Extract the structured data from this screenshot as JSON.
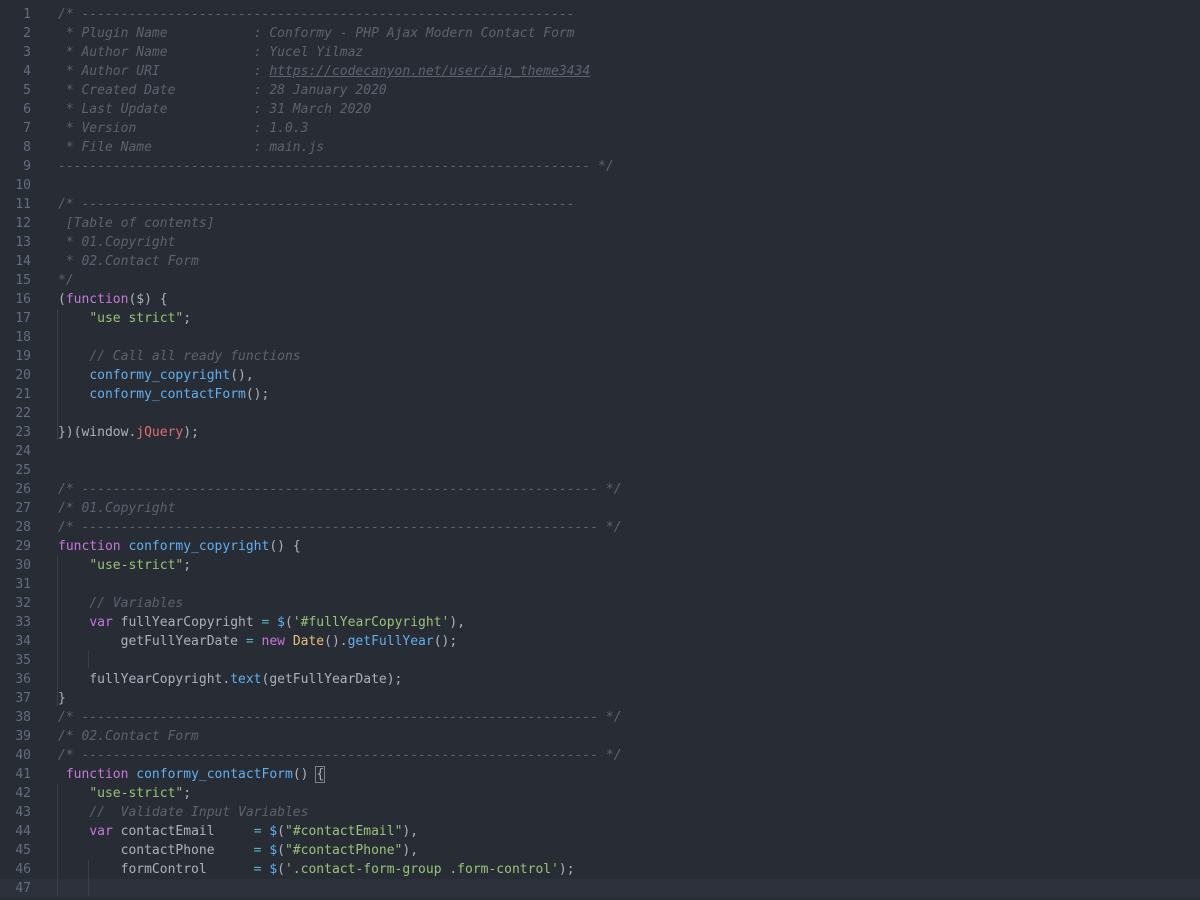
{
  "editor": {
    "active_line": 47,
    "lines": [
      {
        "n": "1",
        "t": [
          [
            "comment",
            "/* ---------------------------------------------------------------"
          ]
        ]
      },
      {
        "n": "2",
        "t": [
          [
            "comment",
            " * Plugin Name           : Conformy - PHP Ajax Modern Contact Form"
          ]
        ]
      },
      {
        "n": "3",
        "t": [
          [
            "comment",
            " * Author Name           : Yucel Yilmaz"
          ]
        ]
      },
      {
        "n": "4",
        "t": [
          [
            "comment",
            " * Author URI            : "
          ],
          [
            "link",
            "https://codecanyon.net/user/aip_theme3434"
          ]
        ]
      },
      {
        "n": "5",
        "t": [
          [
            "comment",
            " * Created Date          : 28 January 2020"
          ]
        ]
      },
      {
        "n": "6",
        "t": [
          [
            "comment",
            " * Last Update           : 31 March 2020"
          ]
        ]
      },
      {
        "n": "7",
        "t": [
          [
            "comment",
            " * Version               : 1.0.3"
          ]
        ]
      },
      {
        "n": "8",
        "t": [
          [
            "comment",
            " * File Name             : main.js"
          ]
        ]
      },
      {
        "n": "9",
        "t": [
          [
            "comment",
            "-------------------------------------------------------------------- */"
          ]
        ]
      },
      {
        "n": "10",
        "t": []
      },
      {
        "n": "11",
        "t": [
          [
            "comment",
            "/* ---------------------------------------------------------------"
          ]
        ]
      },
      {
        "n": "12",
        "t": [
          [
            "comment",
            " [Table of contents]"
          ]
        ]
      },
      {
        "n": "13",
        "t": [
          [
            "comment",
            " * 01.Copyright"
          ]
        ]
      },
      {
        "n": "14",
        "t": [
          [
            "comment",
            " * 02.Contact Form"
          ]
        ]
      },
      {
        "n": "15",
        "t": [
          [
            "comment",
            "*/"
          ]
        ]
      },
      {
        "n": "16",
        "t": [
          [
            "plain",
            "("
          ],
          [
            "keyword",
            "function"
          ],
          [
            "plain",
            "($) {"
          ]
        ]
      },
      {
        "n": "17",
        "t": [
          [
            "plain",
            "    "
          ],
          [
            "string",
            "\"use strict\""
          ],
          [
            "plain",
            ";"
          ]
        ]
      },
      {
        "n": "18",
        "t": []
      },
      {
        "n": "19",
        "t": [
          [
            "plain",
            "    "
          ],
          [
            "comment",
            "// Call all ready functions"
          ]
        ]
      },
      {
        "n": "20",
        "t": [
          [
            "plain",
            "    "
          ],
          [
            "fn",
            "conformy_copyright"
          ],
          [
            "plain",
            "(),"
          ]
        ]
      },
      {
        "n": "21",
        "t": [
          [
            "plain",
            "    "
          ],
          [
            "fn",
            "conformy_contactForm"
          ],
          [
            "plain",
            "();"
          ]
        ]
      },
      {
        "n": "22",
        "t": []
      },
      {
        "n": "23",
        "t": [
          [
            "plain",
            "})(window."
          ],
          [
            "prop",
            "jQuery"
          ],
          [
            "plain",
            ");"
          ]
        ]
      },
      {
        "n": "24",
        "t": []
      },
      {
        "n": "25",
        "t": []
      },
      {
        "n": "26",
        "t": [
          [
            "comment",
            "/* ------------------------------------------------------------------ */"
          ]
        ]
      },
      {
        "n": "27",
        "t": [
          [
            "comment",
            "/* 01.Copyright"
          ]
        ]
      },
      {
        "n": "28",
        "t": [
          [
            "comment",
            "/* ------------------------------------------------------------------ */"
          ]
        ]
      },
      {
        "n": "29",
        "t": [
          [
            "keyword",
            "function"
          ],
          [
            "plain",
            " "
          ],
          [
            "fn",
            "conformy_copyright"
          ],
          [
            "plain",
            "() {"
          ]
        ]
      },
      {
        "n": "30",
        "t": [
          [
            "plain",
            "    "
          ],
          [
            "string",
            "\"use-strict\""
          ],
          [
            "plain",
            ";"
          ]
        ]
      },
      {
        "n": "31",
        "t": []
      },
      {
        "n": "32",
        "t": [
          [
            "plain",
            "    "
          ],
          [
            "comment",
            "// Variables"
          ]
        ]
      },
      {
        "n": "33",
        "t": [
          [
            "plain",
            "    "
          ],
          [
            "keyword",
            "var"
          ],
          [
            "plain",
            " fullYearCopyright "
          ],
          [
            "op",
            "="
          ],
          [
            "plain",
            " "
          ],
          [
            "fn",
            "$"
          ],
          [
            "plain",
            "("
          ],
          [
            "string",
            "'#fullYearCopyright'"
          ],
          [
            "plain",
            "),"
          ]
        ]
      },
      {
        "n": "34",
        "t": [
          [
            "plain",
            "        getFullYearDate "
          ],
          [
            "op",
            "="
          ],
          [
            "plain",
            " "
          ],
          [
            "keyword",
            "new"
          ],
          [
            "plain",
            " "
          ],
          [
            "class",
            "Date"
          ],
          [
            "plain",
            "()."
          ],
          [
            "fn",
            "getFullYear"
          ],
          [
            "plain",
            "();"
          ]
        ]
      },
      {
        "n": "35",
        "t": []
      },
      {
        "n": "36",
        "t": [
          [
            "plain",
            "    fullYearCopyright."
          ],
          [
            "fn",
            "text"
          ],
          [
            "plain",
            "(getFullYearDate);"
          ]
        ]
      },
      {
        "n": "37",
        "t": [
          [
            "plain",
            "}"
          ]
        ]
      },
      {
        "n": "38",
        "t": [
          [
            "comment",
            "/* ------------------------------------------------------------------ */"
          ]
        ]
      },
      {
        "n": "39",
        "t": [
          [
            "comment",
            "/* 02.Contact Form"
          ]
        ]
      },
      {
        "n": "40",
        "t": [
          [
            "comment",
            "/* ------------------------------------------------------------------ */"
          ]
        ]
      },
      {
        "n": "41",
        "t": [
          [
            "plain",
            " "
          ],
          [
            "keyword",
            "function"
          ],
          [
            "plain",
            " "
          ],
          [
            "fn",
            "conformy_contactForm"
          ],
          [
            "plain",
            "() "
          ],
          [
            "bracket",
            "{"
          ]
        ]
      },
      {
        "n": "42",
        "t": [
          [
            "plain",
            "    "
          ],
          [
            "string",
            "\"use-strict\""
          ],
          [
            "plain",
            ";"
          ]
        ]
      },
      {
        "n": "43",
        "t": [
          [
            "plain",
            "    "
          ],
          [
            "comment",
            "//  Validate Input Variables"
          ]
        ]
      },
      {
        "n": "44",
        "t": [
          [
            "plain",
            "    "
          ],
          [
            "keyword",
            "var"
          ],
          [
            "plain",
            " contactEmail     "
          ],
          [
            "op",
            "="
          ],
          [
            "plain",
            " "
          ],
          [
            "fn",
            "$"
          ],
          [
            "plain",
            "("
          ],
          [
            "string",
            "\"#contactEmail\""
          ],
          [
            "plain",
            "),"
          ]
        ]
      },
      {
        "n": "45",
        "t": [
          [
            "plain",
            "        contactPhone     "
          ],
          [
            "op",
            "="
          ],
          [
            "plain",
            " "
          ],
          [
            "fn",
            "$"
          ],
          [
            "plain",
            "("
          ],
          [
            "string",
            "\"#contactPhone\""
          ],
          [
            "plain",
            "),"
          ]
        ]
      },
      {
        "n": "46",
        "t": [
          [
            "plain",
            "        formControl      "
          ],
          [
            "op",
            "="
          ],
          [
            "plain",
            " "
          ],
          [
            "fn",
            "$"
          ],
          [
            "plain",
            "("
          ],
          [
            "string",
            "'.contact-form-group .form-control'"
          ],
          [
            "plain",
            ");"
          ]
        ]
      },
      {
        "n": "47",
        "t": []
      }
    ]
  }
}
